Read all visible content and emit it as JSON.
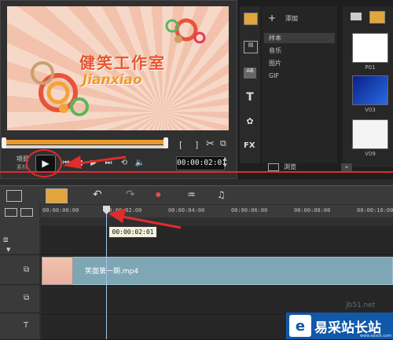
{
  "preview": {
    "title_cn": "健笑工作室",
    "title_en": "Jianxiao",
    "timecode": "00:00:02:01",
    "project_label": "项目",
    "clip_label": "素材",
    "bracket_open": "[",
    "bracket_close": "]"
  },
  "library": {
    "add_label": "添加",
    "items": [
      "样本",
      "音乐",
      "图片",
      "GIF"
    ],
    "bottom_label": "浏览",
    "thumbs": [
      "P01",
      "V03",
      "V09"
    ],
    "side_icons": [
      "media-icon",
      "instant-project-icon",
      "transition-icon",
      "title-icon",
      "graphic-icon",
      "filter-icon"
    ]
  },
  "timeline": {
    "ruler_ticks": [
      "00:00:00:00",
      "00:00:02:00",
      "00:00:04:00",
      "00:00:06:00",
      "00:00:08:00",
      "00:00:10:00"
    ],
    "tooltip_time": "00:00:02:01",
    "clip_name": "笑面第一期.mp4"
  },
  "watermark": {
    "brand": "易采站长站",
    "site": "www.easck.com",
    "faint": "jb51.net"
  },
  "colors": {
    "accent_orange": "#e89a2d",
    "clip_blue": "#7fa6b4",
    "annotation_red": "#e12c2c",
    "watermark_blue": "#1158a8"
  }
}
